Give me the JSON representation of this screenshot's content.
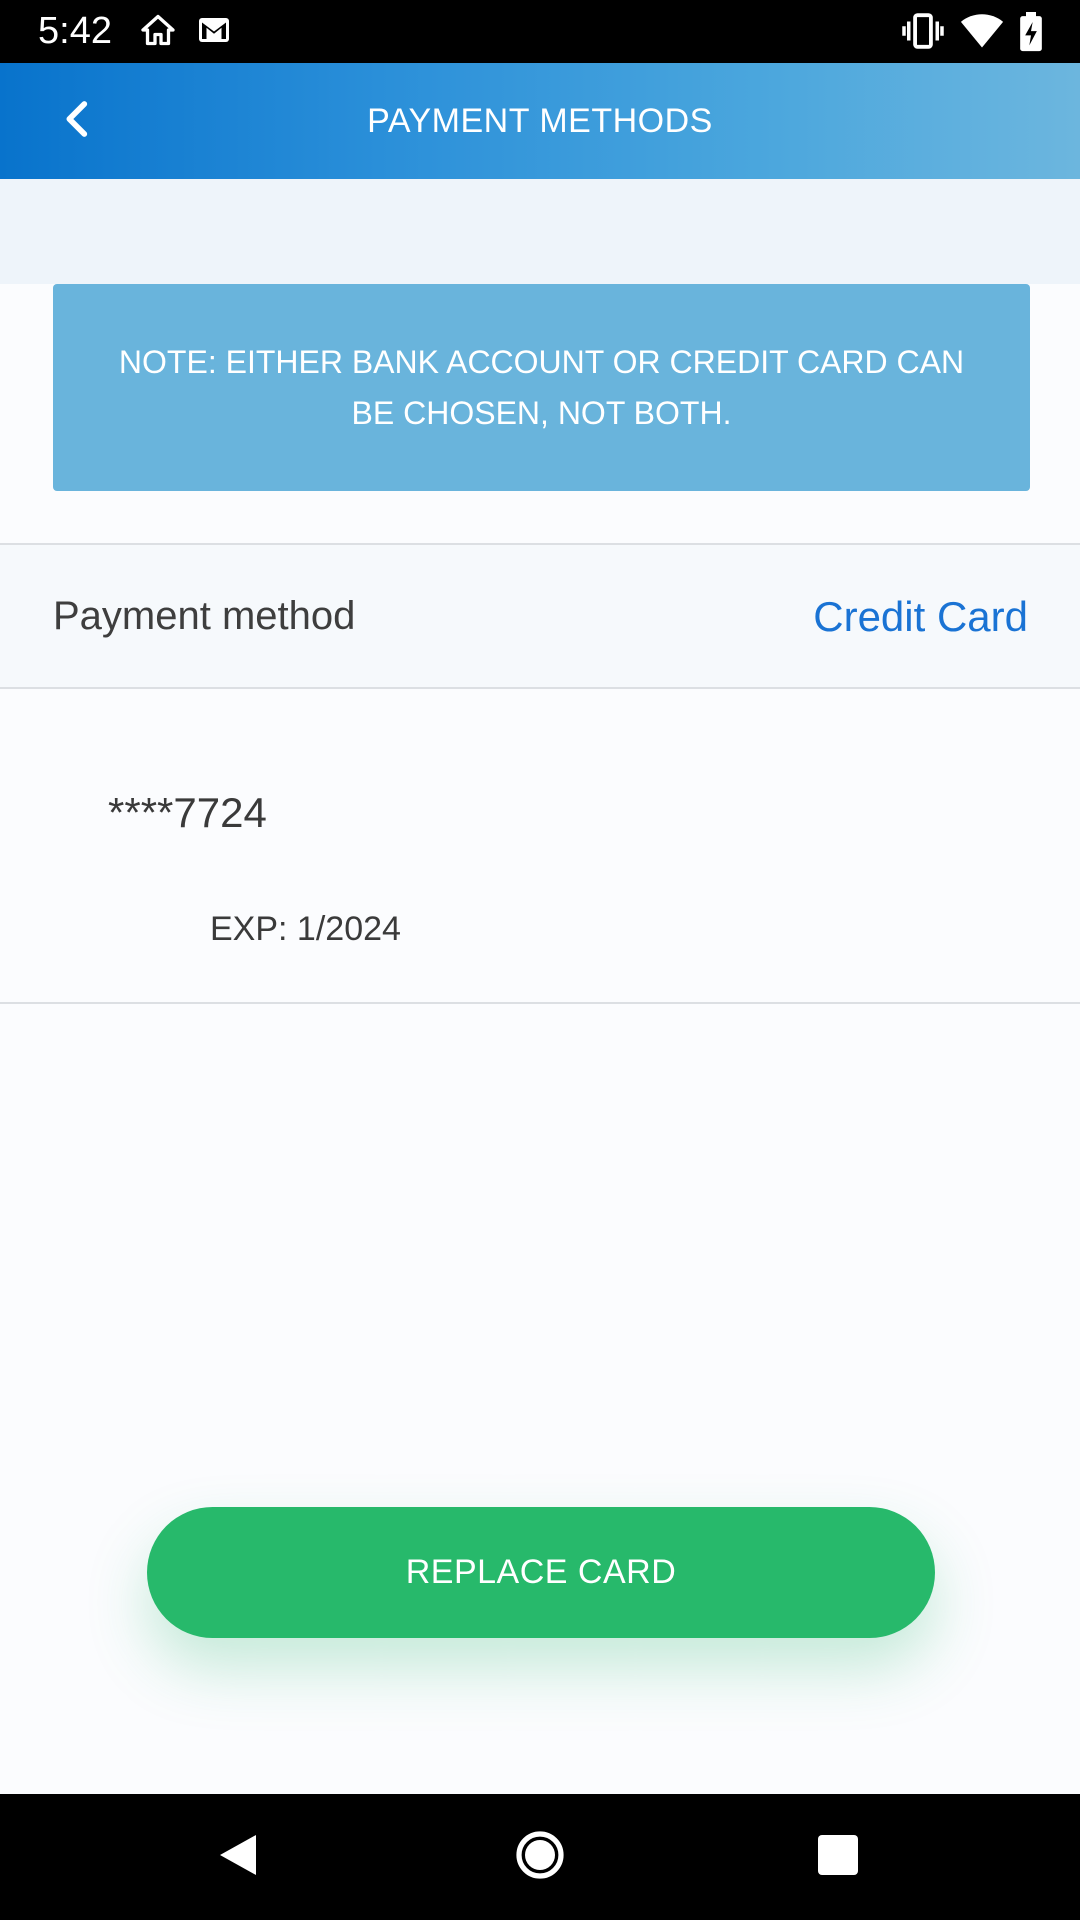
{
  "status_bar": {
    "time": "5:42",
    "left_icons": [
      "home-icon",
      "gmail-icon"
    ],
    "right_icons": [
      "vibrate-icon",
      "wifi-icon",
      "battery-charging-icon"
    ]
  },
  "app_bar": {
    "title": "PAYMENT METHODS",
    "back_icon": "chevron-left-icon"
  },
  "note": {
    "text": "NOTE: EITHER BANK ACCOUNT OR CREDIT CARD CAN BE CHOSEN, NOT BOTH."
  },
  "payment_method": {
    "label": "Payment method",
    "value": "Credit Card"
  },
  "card": {
    "number": "****7724",
    "expiry": "EXP: 1/2024"
  },
  "actions": {
    "replace_label": "REPLACE CARD"
  },
  "nav_bar": {
    "icons": [
      "back-triangle-icon",
      "home-circle-icon",
      "recents-square-icon"
    ]
  },
  "colors": {
    "app_bar_start": "#0873cc",
    "app_bar_end": "#6cb6de",
    "note_bg": "#69b4dc",
    "link": "#1a73d4",
    "button": "#27b96b"
  }
}
